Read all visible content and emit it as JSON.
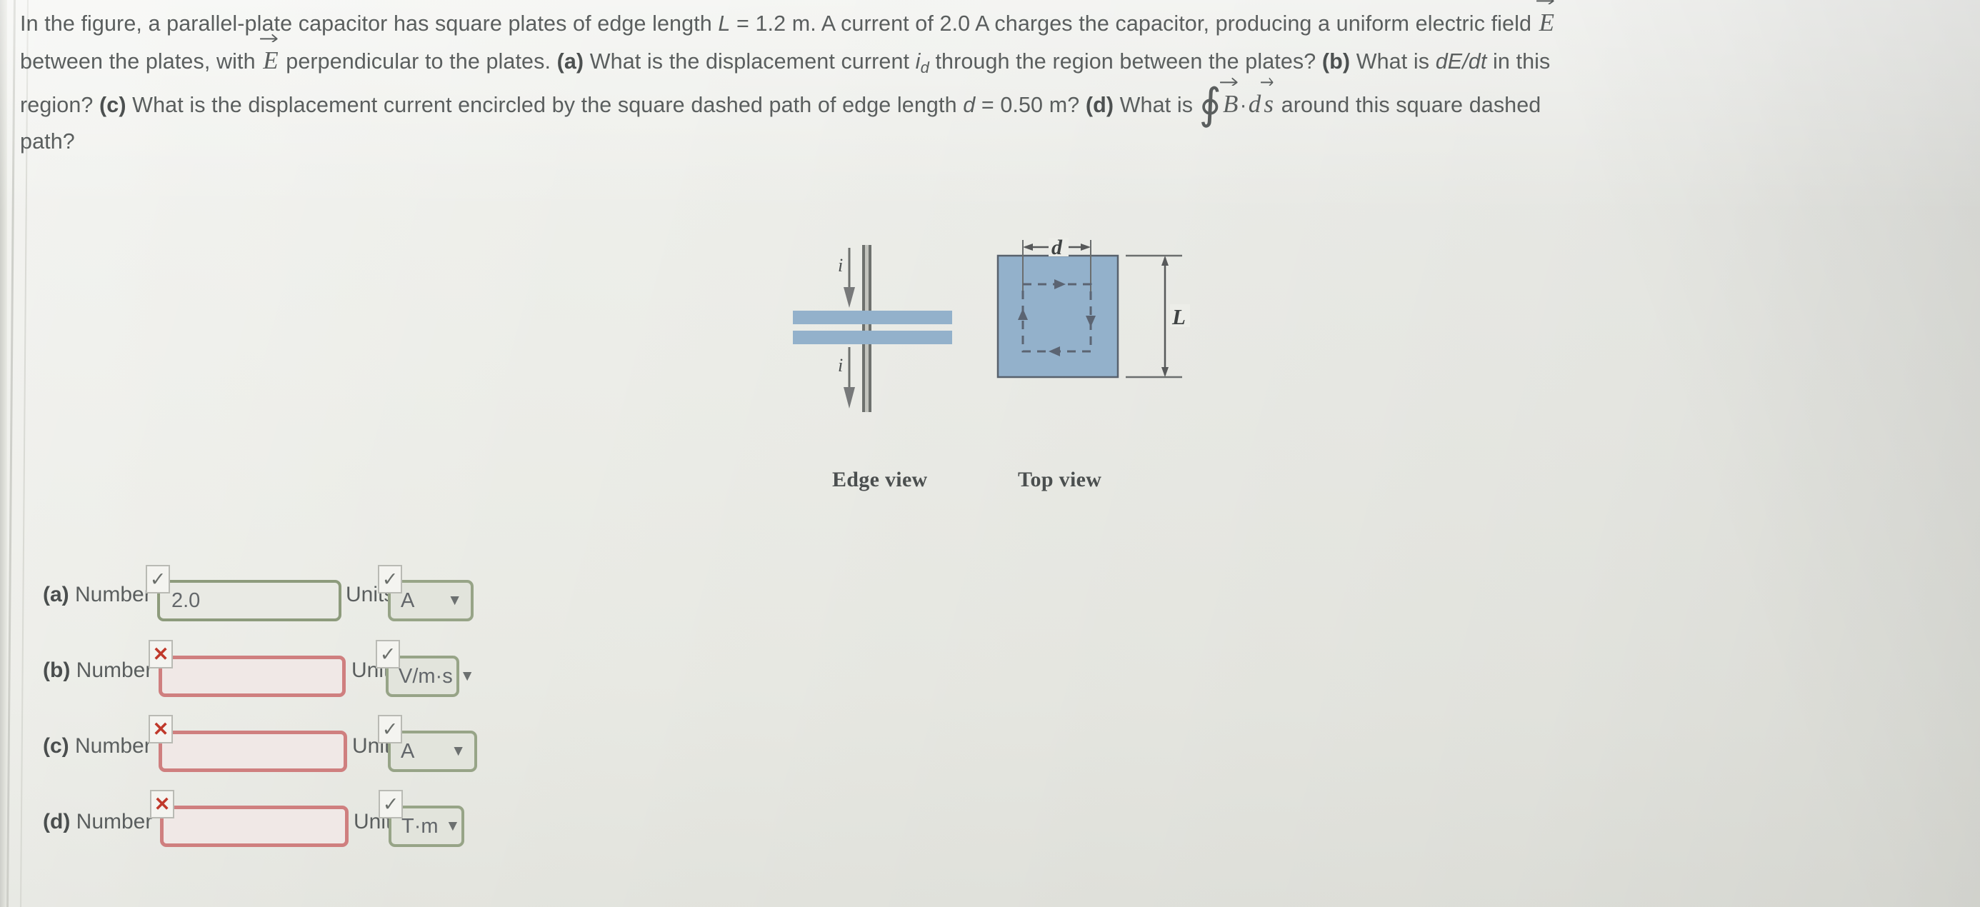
{
  "question": {
    "line1_a": "In the figure, a parallel-plate capacitor has square plates of edge length ",
    "var_L": "L",
    "line1_b": " = 1.2 m. A current of 2.0 A charges the capacitor, producing a uniform electric field ",
    "vec_E": "E",
    "line2_a": "between the plates, with ",
    "line2_b": " perpendicular to the plates. ",
    "part_a": "(a)",
    "line2_c": " What is the displacement current ",
    "var_id": "i",
    "var_id_sub": "d",
    "line2_d": " through the region between the plates? ",
    "part_b": "(b)",
    "line2_e": " What is ",
    "dEdt": "dE/dt",
    "line2_f": " in this",
    "line3_a": "region? ",
    "part_c": "(c)",
    "line3_b": " What is the displacement current encircled by the square dashed path of edge length ",
    "var_d": "d",
    "line3_c": " = 0.50 m? ",
    "part_d": "(d)",
    "line3_d": " What is ",
    "contour_integral": "∮",
    "vec_B": "B",
    "dot": "·",
    "d_scalar": "d",
    "vec_s": "s",
    "line3_e": " around this square dashed",
    "line4": "path?"
  },
  "figure": {
    "edge_view_caption": "Edge view",
    "top_view_caption": "Top view",
    "current_label_top": "i",
    "current_label_bottom": "i",
    "dim_d_label": "d",
    "dim_L_label": "L",
    "plate_color": "#8fadc9",
    "plate_fill": "#93b1cb",
    "wire_color": "#777a77",
    "dash_color": "#5b6472"
  },
  "answers": {
    "units_label": "Units",
    "number_label": "Number",
    "rows": [
      {
        "key": "(a)",
        "number_value": "2.0",
        "number_status": "correct",
        "number_badge": "✓",
        "units_value": "A",
        "units_status": "correct",
        "units_badge": "✓",
        "caret": "▼"
      },
      {
        "key": "(b)",
        "number_value": "",
        "number_status": "incorrect",
        "number_badge": "✕",
        "units_value": "V/m·s",
        "units_status": "correct",
        "units_badge": "✓",
        "caret": "▼"
      },
      {
        "key": "(c)",
        "number_value": "",
        "number_status": "incorrect",
        "number_badge": "✕",
        "units_value": "A",
        "units_status": "correct",
        "units_badge": "✓",
        "caret": "▼"
      },
      {
        "key": "(d)",
        "number_value": "",
        "number_status": "incorrect",
        "number_badge": "✕",
        "units_value": "T·m",
        "units_status": "correct",
        "units_badge": "✓",
        "caret": "▼"
      }
    ]
  },
  "colors": {
    "page_background": "#ebece6",
    "text": "#5a5e5e",
    "correct_border": "#8d9b7c",
    "incorrect_border": "#cf7f7f",
    "incorrect_mark": "#c0392b",
    "select_border": "#97a487"
  }
}
